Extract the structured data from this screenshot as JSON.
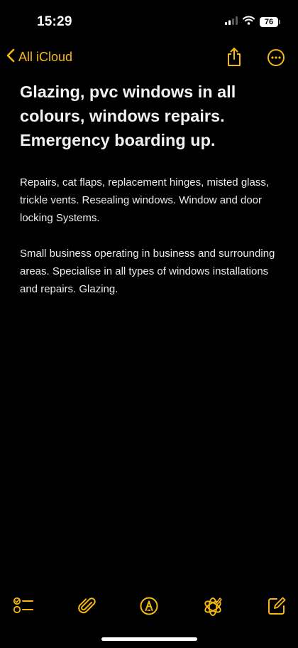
{
  "status_bar": {
    "time": "15:29",
    "battery_level": "76",
    "signal_icon": "cellular-signal-icon",
    "wifi_icon": "wifi-icon"
  },
  "nav": {
    "back_label": "All iCloud",
    "back_icon": "chevron-left-icon",
    "share_icon": "share-icon",
    "more_icon": "ellipsis-circle-icon"
  },
  "note": {
    "title": "Glazing, pvc windows in all colours, windows repairs. Emergency boarding up.",
    "paragraphs": [
      "Repairs, cat flaps, replacement hinges, misted glass, trickle vents. Resealing windows. Window and door locking Systems.",
      "Small business operating in business and surrounding areas. Specialise in all types of windows installations and repairs. Glazing."
    ]
  },
  "toolbar": {
    "items": [
      "checklist-icon",
      "paperclip-icon",
      "markup-pen-icon",
      "writing-tools-icon",
      "compose-icon"
    ]
  },
  "colors": {
    "accent": "#f5b90f",
    "background": "#000000",
    "text": "#ffffff"
  }
}
